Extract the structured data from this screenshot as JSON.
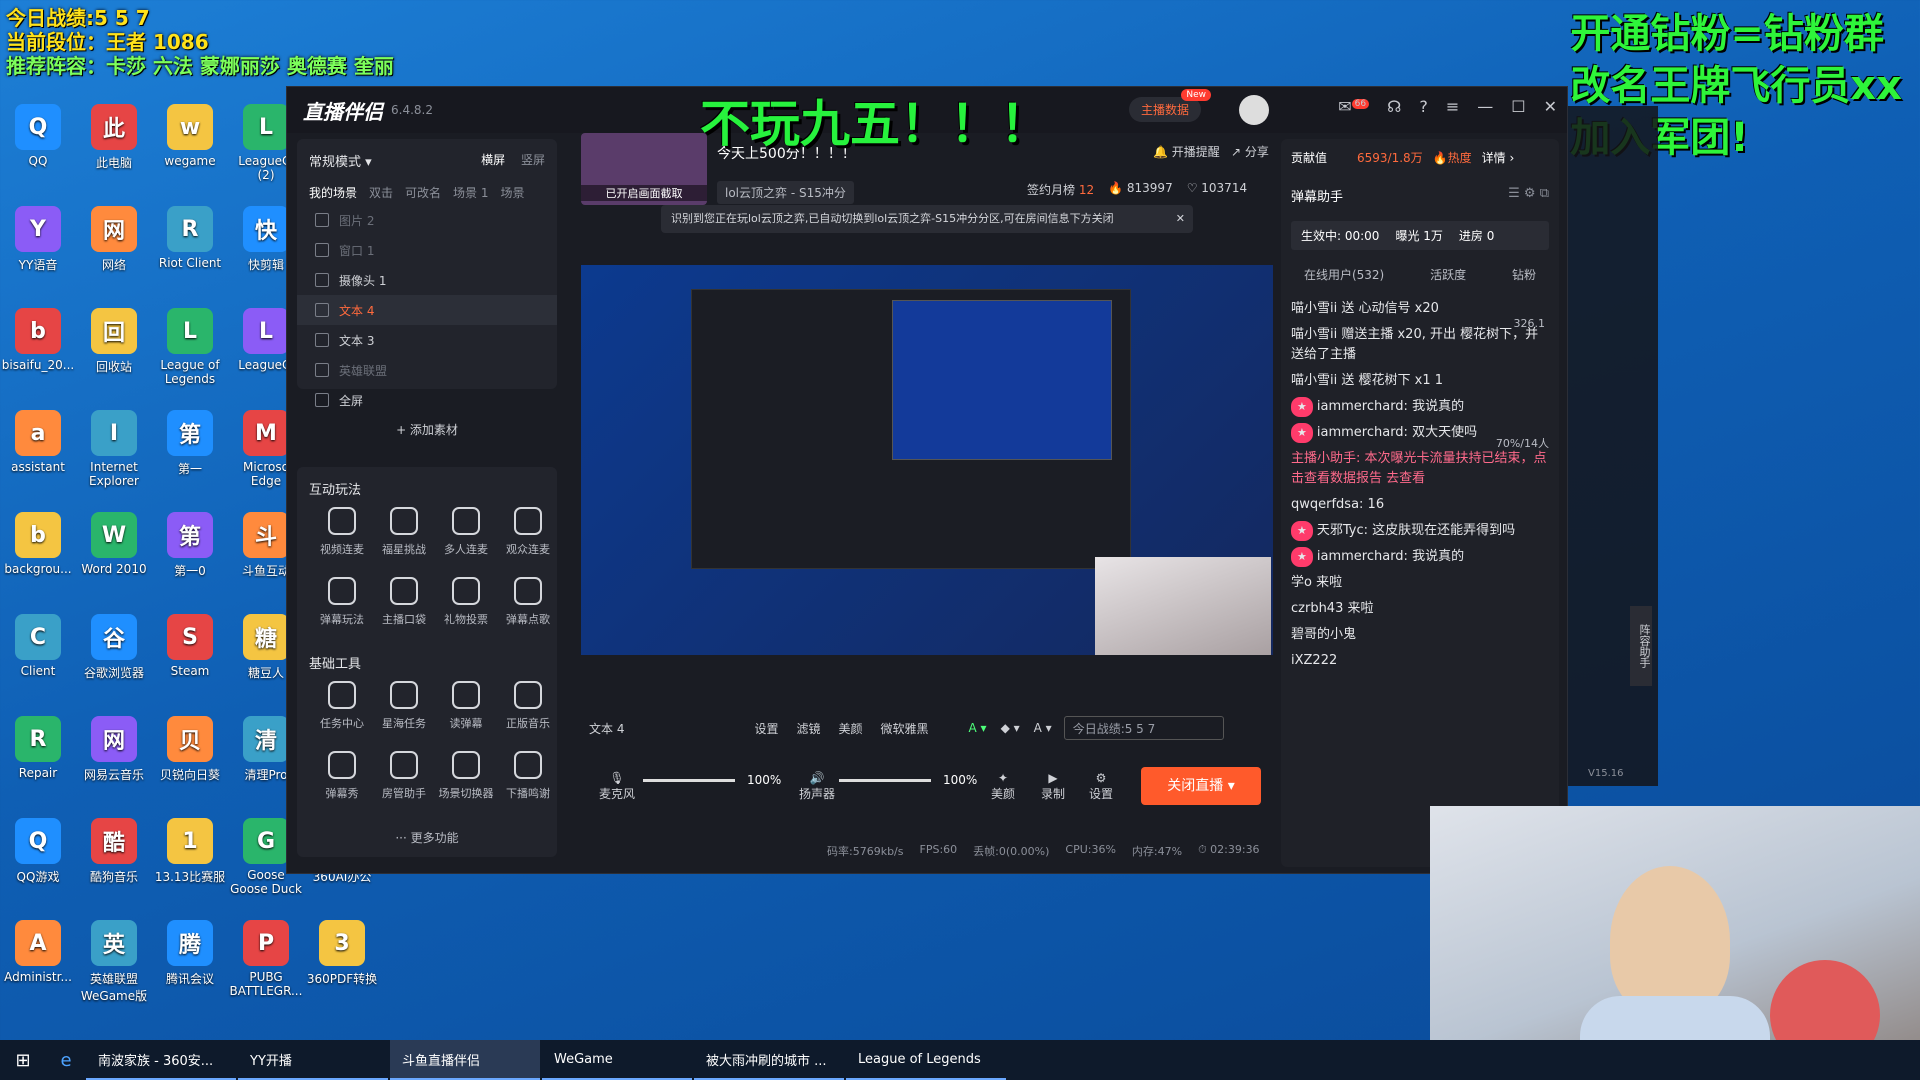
{
  "overlay_tl": {
    "line1": "今日战绩:5 5 7",
    "line2": "当前段位：王者 1086",
    "line3": "推荐阵容：卡莎 六法 蒙娜丽莎 奥德赛 奎丽"
  },
  "overlay_tr": {
    "line1": "开通钻粉=钻粉群",
    "line2": "改名王牌飞行员xx",
    "line3": "加入军团!"
  },
  "big_title": "不玩九五！！！",
  "desktop_icons": [
    {
      "label": "QQ"
    },
    {
      "label": "此电脑"
    },
    {
      "label": "wegame"
    },
    {
      "label": "LeagueCl (2)"
    },
    {
      "label": "YY语音"
    },
    {
      "label": "网络"
    },
    {
      "label": "Riot Client"
    },
    {
      "label": "快剪辑"
    },
    {
      "label": "bisaifu_20..."
    },
    {
      "label": "回收站"
    },
    {
      "label": "League of Legends"
    },
    {
      "label": "LeagueCl"
    },
    {
      "label": "assistant"
    },
    {
      "label": "Internet Explorer"
    },
    {
      "label": "第一"
    },
    {
      "label": "Microso Edge"
    },
    {
      "label": "backgrou..."
    },
    {
      "label": "Word 2010"
    },
    {
      "label": "第一0"
    },
    {
      "label": "斗鱼互动"
    },
    {
      "label": "Client"
    },
    {
      "label": "谷歌浏览器"
    },
    {
      "label": "Steam"
    },
    {
      "label": "糖豆人"
    },
    {
      "label": "Repair"
    },
    {
      "label": "网易云音乐"
    },
    {
      "label": "贝锐向日葵"
    },
    {
      "label": "清理Pro"
    },
    {
      "label": "QQ游戏"
    },
    {
      "label": "酷狗音乐"
    },
    {
      "label": "13.13比赛服"
    },
    {
      "label": "Goose Goose Duck"
    },
    {
      "label": "360AI办公"
    },
    {
      "label": "Administr..."
    },
    {
      "label": "英雄联盟 WeGame版"
    },
    {
      "label": "腾讯会议"
    },
    {
      "label": "PUBG BATTLEGR..."
    },
    {
      "label": "360PDF转换"
    }
  ],
  "app": {
    "name": "直播伴侣",
    "version": "6.4.8.2",
    "mode": "常规模式",
    "orient_h": "横屏",
    "orient_v": "竖屏",
    "scene_tabs": [
      "我的场景",
      "双击",
      "可改名",
      "场景 1",
      "场景"
    ],
    "sources": [
      "图片 2",
      "窗口 1",
      "摄像头 1",
      "文本 4",
      "文本 3",
      "英雄联盟",
      "全屏"
    ],
    "add_source": "+ 添加素材",
    "interact_title": "互动玩法",
    "interact_tools": [
      "视频连麦",
      "福星挑战",
      "多人连麦",
      "观众连麦",
      "弹幕玩法",
      "主播口袋",
      "礼物投票",
      "弹幕点歌"
    ],
    "basic_title": "基础工具",
    "basic_tools": [
      "任务中心",
      "星海任务",
      "读弹幕",
      "正版音乐",
      "弹幕秀",
      "房管助手",
      "场景切换器",
      "下播鸣谢"
    ],
    "more": "··· 更多功能",
    "stream_title": "今天上500分！！！！",
    "category": "lol云顶之弈 - S15冲分",
    "thumb_label": "已开启画面截取",
    "remind": "开播提醒",
    "share": "分享",
    "sign_rank": "签约月榜",
    "sign_num": "12",
    "fans": "813997",
    "likes": "103714",
    "notice": "识别到您正在玩lol云顶之弈,已自动切换到lol云顶之弈-S15冲分分区,可在房间信息下方关闭",
    "live_data": "主播数据",
    "new_badge": "New",
    "msg_count": "66",
    "text_source": "文本 4",
    "toolbar": [
      "设置",
      "滤镜",
      "美颜",
      "微软雅黑"
    ],
    "text_value": "今日战绩:5 5 7",
    "mic": "麦克风",
    "mic_vol": "100%",
    "speaker": "扬声器",
    "speaker_vol": "100%",
    "beauty": "美颜",
    "record": "录制",
    "settings": "设置",
    "stop_live": "关闭直播",
    "status_bitrate": "码率:5769kb/s",
    "status_fps": "FPS:60",
    "status_drop": "丢帧:0(0.00%)",
    "status_cpu": "CPU:36%",
    "status_mem": "内存:47%",
    "status_time": "02:39:36"
  },
  "right_panel": {
    "contribution": "贡献值",
    "contrib_value": "6593/1.8万",
    "heat": "热度",
    "detail": "详情",
    "assistant": "弹幕助手",
    "effect_time": "生效中: 00:00",
    "exposure": "曝光 1万",
    "entered": "进房 0",
    "tabs": [
      "在线用户(532)",
      "活跃度",
      "钻粉"
    ],
    "viewer_count": "326.1",
    "messages": [
      "喵小雪ii 送 心动信号 x20",
      "喵小雪ii 赠送主播 x20, 开出 樱花树下，并送给了主播",
      "喵小雪ii 送 樱花树下 x1 1",
      "iammerchard: 我说真的",
      "iammerchard: 双大天使吗",
      "主播小助手: 本次曝光卡流量扶持已结束，点击查看数据报告 去查看",
      "qwqerfdsa: 16",
      "天邪Tyc: 这皮肤现在还能弄得到吗",
      "iammerchard: 我说真的",
      "学o 来啦",
      "czrbh43 来啦",
      "碧哥的小鬼",
      "iXZ222"
    ],
    "rank_badge": "70%/14人"
  },
  "taskbar": {
    "items": [
      "南波家族 - 360安...",
      "YY开播",
      "斗鱼直播伴侣",
      "WeGame",
      "被大雨冲刷的城市 ...",
      "League of Legends"
    ]
  },
  "right_side_text": [
    "V15.16",
    "阵容助手"
  ]
}
